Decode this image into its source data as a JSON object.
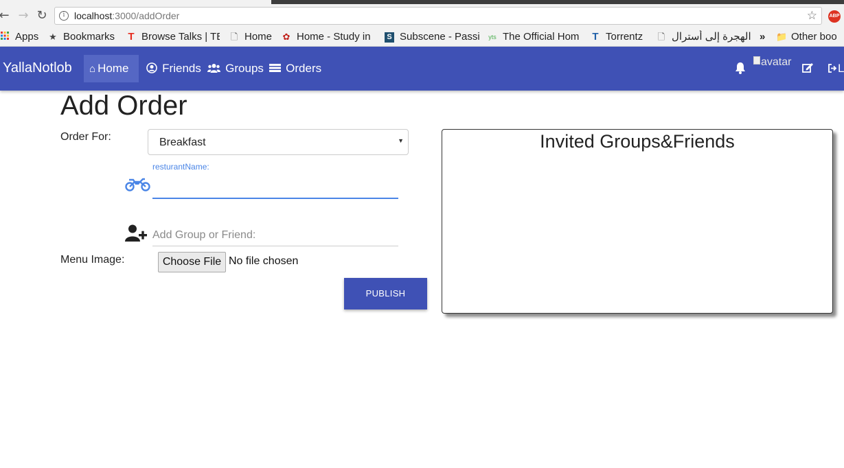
{
  "browser": {
    "url_host": "localhost",
    "url_path": ":3000/addOrder",
    "abp_label": "ABP"
  },
  "bookmarks": [
    {
      "label": "Apps",
      "icon": "apps-grid-icon",
      "color": "#e53935"
    },
    {
      "label": "Bookmarks",
      "icon": "star-icon",
      "color": "#444444"
    },
    {
      "label": "Browse Talks | TE",
      "icon": "ted-icon",
      "color": "#e62b1e"
    },
    {
      "label": "Home",
      "icon": "page-icon",
      "color": "#555555"
    },
    {
      "label": "Home - Study in",
      "icon": "flower-icon",
      "color": "#c0201a"
    },
    {
      "label": "Subscene - Passi",
      "icon": "subscene-icon",
      "color": "#1f4f6e"
    },
    {
      "label": "The Official Hom",
      "icon": "yts-icon",
      "color": "#4caf50"
    },
    {
      "label": "Torrentz",
      "icon": "torrentz-icon",
      "color": "#1f5fa8"
    },
    {
      "label": "الهجرة إلى أسترال",
      "icon": "page-icon",
      "color": "#555555"
    },
    {
      "label": "»",
      "icon": "overflow-icon",
      "color": "#222222"
    },
    {
      "label": "Other boo",
      "icon": "folder-icon",
      "color": "#666666"
    }
  ],
  "navbar": {
    "brand": "YallaNotlob",
    "links": [
      {
        "label": "Home",
        "icon": "home-icon",
        "active": true
      },
      {
        "label": "Friends",
        "icon": "user-circle-icon",
        "active": false
      },
      {
        "label": "Groups",
        "icon": "users-icon",
        "active": false
      },
      {
        "label": "Orders",
        "icon": "list-icon",
        "active": false
      }
    ],
    "avatar_alt": "avatar",
    "logout_partial": "L",
    "color": "#3f51b5"
  },
  "form": {
    "title": "Add Order",
    "order_for_label": "Order For:",
    "order_for_value": "Breakfast",
    "restaurant_label": "resturantName:",
    "restaurant_value": "",
    "add_placeholder": "Add Group or Friend:",
    "menu_image_label": "Menu Image:",
    "choose_file_label": "Choose File",
    "file_status": "No file chosen",
    "publish_label": "PUBLISH"
  },
  "invited": {
    "title": "Invited Groups&Friends"
  }
}
